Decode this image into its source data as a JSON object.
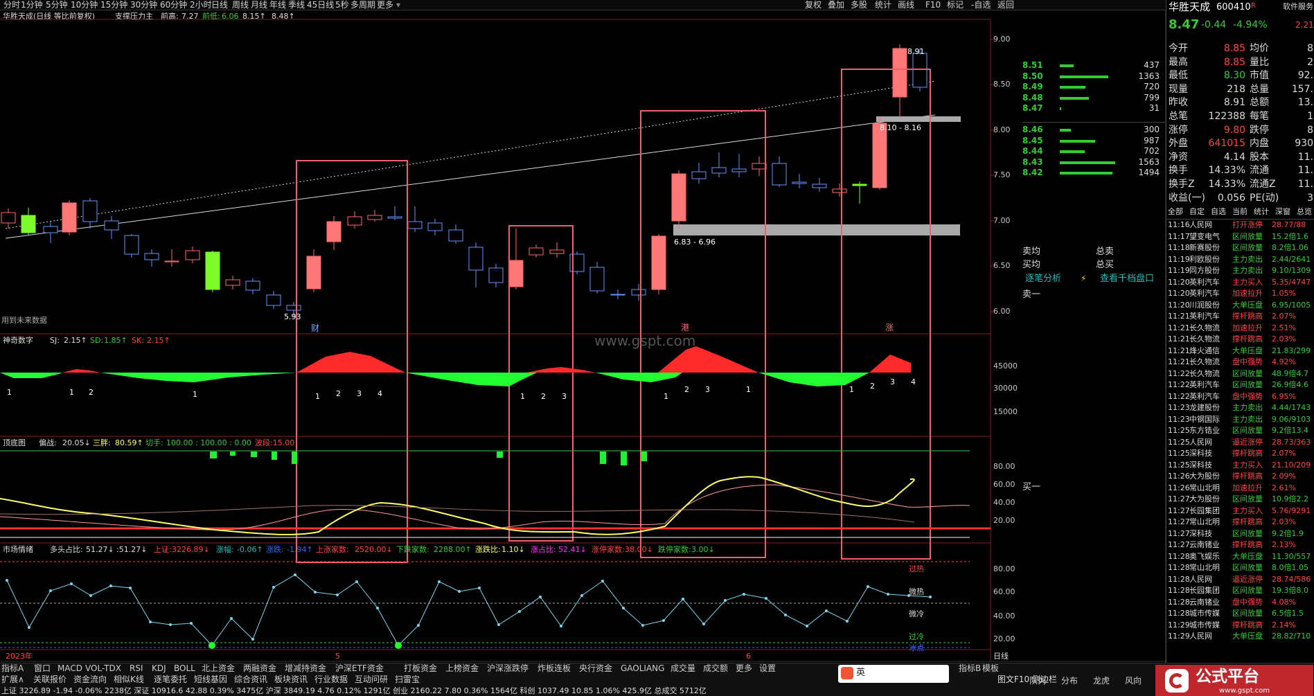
{
  "period_tabs": [
    "分时",
    "1分钟",
    "5分钟",
    "10分钟",
    "15分钟",
    "30分钟",
    "60分钟",
    "2小时",
    "日线",
    "周线",
    "月线",
    "年线",
    "季线",
    "45日线",
    "5秒",
    "多周期",
    "更多"
  ],
  "right_tools": [
    "复权",
    "叠加",
    "多股",
    "统计",
    "画线",
    "F10",
    "标记",
    "-自选",
    "返回"
  ],
  "chart_header": {
    "stock": "华胜天成(日线 等比前复权)",
    "indicator": "支撑压力主",
    "prev_high_label": "前高:",
    "prev_high": "7.27",
    "prev_low_label": "前低:",
    "prev_low": "6.06",
    "v1": "8.15↑",
    "v2": "8.48↑"
  },
  "price_axis": [
    "9.00",
    "8.50",
    "8.00",
    "7.50",
    "7.00",
    "6.50",
    "6.00"
  ],
  "annotations": {
    "high": "8.91",
    "low": "5.93",
    "zone_upper": "8.10 - 8.16",
    "zone_lower": "6.83 - 6.96",
    "future_note": "用到未来数据",
    "mark_cai": "财",
    "mark_gang": "港",
    "mark_zhang": "涨",
    "watermark": "www.gspt.com"
  },
  "panel2": {
    "name": "神奇数字",
    "sj_label": "SJ:",
    "sj": "2.15↑",
    "sd_label": "SD:",
    "sd": "1.85↑",
    "sk_label": "SK:",
    "sk": "2.15↑",
    "axis": [
      "45000",
      "30000",
      "15000"
    ],
    "counts": [
      "1",
      "1",
      "2",
      "1",
      "1",
      "2",
      "3",
      "4",
      "1",
      "2",
      "3",
      "1",
      "2",
      "3",
      "1",
      "1",
      "2",
      "3",
      "4"
    ]
  },
  "panel3": {
    "name": "顶底图",
    "a_label": "偏战:",
    "a": "20.05↓",
    "b_label": "三胖:",
    "b": "80.59↑",
    "c_label": "切手:",
    "c": "100.00 : 100.00 : 0.00",
    "d": "波段:15.00",
    "axis": [
      "80.00",
      "60.00",
      "40.00",
      "20.00"
    ]
  },
  "panel4": {
    "name": "市场情绪",
    "bull_label": "多头占比:",
    "bull": "51.27↓",
    "v2": ":51.27↓",
    "sh_label": "上证:",
    "sh": "3226.89↓",
    "zf_label": "涨幅:",
    "zf": "-0.06↑",
    "zd_label": "涨跌:",
    "zd": "-1.94↑",
    "up_label": "上涨家数:",
    "up": "2520.00↓",
    "down_label": "下跌家数:",
    "down": "2288.00↑",
    "ratio_label": "涨跌比:",
    "ratio": "1.10↓",
    "zzb_label": "涨占比:",
    "zzb": "52.41↓",
    "zt_label": "涨停家数:",
    "zt": "38.00↓",
    "dt_label": "跌停家数:",
    "dt": "3.00↓",
    "axis": [
      "80.00",
      "60.00",
      "40.00",
      "20.00"
    ],
    "zones": [
      "过热",
      "微热",
      "微冷",
      "过冷",
      "冰点"
    ]
  },
  "dates": [
    "2023年",
    "5",
    "6"
  ],
  "side": {
    "name": "华胜天成",
    "code": "600410",
    "badge": "R",
    "price": "8.47",
    "change": "-0.44",
    "pct": "-4.94%",
    "software": "软件服务",
    "extra": "2.21",
    "order_book": [
      {
        "p": "8.51",
        "v": "437",
        "w": 0.25
      },
      {
        "p": "8.50",
        "v": "1363",
        "w": 0.88
      },
      {
        "p": "8.49",
        "v": "720",
        "w": 0.46
      },
      {
        "p": "8.48",
        "v": "799",
        "w": 0.52
      },
      {
        "p": "8.47",
        "v": "31",
        "w": 0.03
      },
      {
        "p": "8.46",
        "v": "300",
        "w": 0.2
      },
      {
        "p": "8.45",
        "v": "987",
        "w": 0.64
      },
      {
        "p": "8.44",
        "v": "702",
        "w": 0.45
      },
      {
        "p": "8.43",
        "v": "1563",
        "w": 1.0
      },
      {
        "p": "8.42",
        "v": "1494",
        "w": 0.95
      }
    ],
    "stats": [
      {
        "l": "今开",
        "v": "8.85",
        "l2": "均价",
        "v2": "8"
      },
      {
        "l": "最高",
        "v": "8.85",
        "l2": "量比",
        "v2": "2"
      },
      {
        "l": "最低",
        "v": "8.30",
        "l2": "市值",
        "v2": "92."
      },
      {
        "l": "现量",
        "v": "218",
        "l2": "总量",
        "v2": "157."
      },
      {
        "l": "昨收",
        "v": "8.91",
        "l2": "总额",
        "v2": "13."
      },
      {
        "l": "总笔",
        "v": "122388",
        "l2": "每笔",
        "v2": "1"
      },
      {
        "l": "涨停",
        "v": "9.80",
        "l2": "跌停",
        "v2": "8"
      },
      {
        "l": "外盘",
        "v": "641015",
        "l2": "内盘",
        "v2": "930"
      },
      {
        "l": "净资",
        "v": "4.14",
        "l2": "股本",
        "v2": "11."
      },
      {
        "l": "换手",
        "v": "14.33%",
        "l2": "流通",
        "v2": "11."
      },
      {
        "l": "换手Z",
        "v": "14.33%",
        "l2": "流通Z",
        "v2": "11."
      },
      {
        "l": "收益(一)",
        "v": "0.056",
        "l2": "PE(动)",
        "v2": "3"
      }
    ],
    "tape_tabs": [
      "全部",
      "自定",
      "自选",
      "当前",
      "统计",
      "深窗",
      "总览"
    ],
    "tape": [
      {
        "t": "11:16",
        "n": "人民网",
        "a": "打开涨停",
        "v": "28.77/88"
      },
      {
        "t": "11:17",
        "n": "望变电气",
        "a": "区间放量",
        "v": "15.2倍1.6"
      },
      {
        "t": "11:18",
        "n": "新赛股份",
        "a": "区间放量",
        "v": "8.2倍1.06"
      },
      {
        "t": "11:19",
        "n": "利欧股份",
        "a": "主力卖出",
        "v": "2.44/2641"
      },
      {
        "t": "11:19",
        "n": "同方股份",
        "a": "主力卖出",
        "v": "9.10/1309"
      },
      {
        "t": "11:20",
        "n": "英利汽车",
        "a": "主力买入",
        "v": "5.35/4747"
      },
      {
        "t": "11:20",
        "n": "英利汽车",
        "a": "加速拉升",
        "v": "1.05%"
      },
      {
        "t": "11:20",
        "n": "川润股份",
        "a": "大单压盘",
        "v": "6.95/1005"
      },
      {
        "t": "11:21",
        "n": "英利汽车",
        "a": "撑杆跳高",
        "v": "2.07%"
      },
      {
        "t": "11:21",
        "n": "长久物流",
        "a": "加速拉升",
        "v": "2.51%"
      },
      {
        "t": "11:21",
        "n": "长久物流",
        "a": "撑杆跳高",
        "v": "2.03%"
      },
      {
        "t": "11:21",
        "n": "烽火通信",
        "a": "大单压盘",
        "v": "21.83/299"
      },
      {
        "t": "11:21",
        "n": "长久物流",
        "a": "盘中强势",
        "v": "4.92%"
      },
      {
        "t": "11:22",
        "n": "长久物流",
        "a": "区间放量",
        "v": "48.9倍4.7"
      },
      {
        "t": "11:22",
        "n": "英利汽车",
        "a": "区间放量",
        "v": "26.9倍4.6"
      },
      {
        "t": "11:22",
        "n": "英利汽车",
        "a": "盘中强势",
        "v": "6.95%"
      },
      {
        "t": "11:23",
        "n": "龙建股份",
        "a": "主力卖出",
        "v": "4.44/1743"
      },
      {
        "t": "11:23",
        "n": "中钢国际",
        "a": "主力卖出",
        "v": "9.06/9103"
      },
      {
        "t": "11:25",
        "n": "东方锆业",
        "a": "区间放量",
        "v": "9.2倍13.4"
      },
      {
        "t": "11:25",
        "n": "人民网",
        "a": "逼近涨停",
        "v": "28.73/363"
      },
      {
        "t": "11:25",
        "n": "深科技",
        "a": "撑杆跳高",
        "v": "2.07%"
      },
      {
        "t": "11:25",
        "n": "深科技",
        "a": "主力买入",
        "v": "21.10/209"
      },
      {
        "t": "11:26",
        "n": "大为股份",
        "a": "撑杆跳高",
        "v": "2.09%"
      },
      {
        "t": "11:26",
        "n": "常山北明",
        "a": "加速拉升",
        "v": "2.61%"
      },
      {
        "t": "11:27",
        "n": "大为股份",
        "a": "区间放量",
        "v": "10.9倍2.2"
      },
      {
        "t": "11:27",
        "n": "长园集团",
        "a": "主力买入",
        "v": "5.76/9291"
      },
      {
        "t": "11:27",
        "n": "常山北明",
        "a": "撑杆跳高",
        "v": "2.03%"
      },
      {
        "t": "11:27",
        "n": "深科技",
        "a": "区间放量",
        "v": "9.2倍1.9"
      },
      {
        "t": "11:27",
        "n": "云南锗业",
        "a": "撑杆跳高",
        "v": "2.13%"
      },
      {
        "t": "11:28",
        "n": "奥飞娱乐",
        "a": "大单压盘",
        "v": "11.30/557"
      },
      {
        "t": "11:28",
        "n": "常山北明",
        "a": "区间放量",
        "v": "8.0倍1.05"
      },
      {
        "t": "11:28",
        "n": "人民网",
        "a": "逼近涨停",
        "v": "28.74/586"
      },
      {
        "t": "11:28",
        "n": "长园集团",
        "a": "区间放量",
        "v": "19.3倍8.0"
      },
      {
        "t": "11:28",
        "n": "云南锗业",
        "a": "盘中强势",
        "v": "4.08%"
      },
      {
        "t": "11:28",
        "n": "城市传媒",
        "a": "区间放量",
        "v": "6.5倍1.5"
      },
      {
        "t": "11:29",
        "n": "城市传媒",
        "a": "撑杆跳高",
        "v": "2.14%"
      },
      {
        "t": "11:29",
        "n": "人民网",
        "a": "大单压盘",
        "v": "28.82/710"
      }
    ]
  },
  "mid": {
    "sell_avg": "卖均",
    "buy_avg": "买均",
    "total_sell": "总卖",
    "total_buy": "总买",
    "tick": "逐笔分析",
    "depth": "查看千档盘口",
    "sell1": "卖一",
    "buy1": "买一"
  },
  "indicator_tabs": [
    "指标A",
    "窗口",
    "MACD",
    "VOL-TDX",
    "RSI",
    "KDJ",
    "BOLL",
    "北上资金",
    "两融资金",
    "增减持资金",
    "沪深ETF资金",
    "打板资金",
    "上榜资金",
    "沪深涨跌停",
    "炸板连板",
    "央行资金",
    "GAOLIANG",
    "成交量",
    "成交额",
    "更多",
    "设置"
  ],
  "right_tabs": [
    "指标B",
    "模板"
  ],
  "sub_tabs": [
    "扩展∧",
    "关联报价",
    "资金流向",
    "相似K线",
    "逐笔委托",
    "短线基因",
    "综合资讯",
    "板块资讯",
    "行业数据",
    "互动问研",
    "扫雷宝"
  ],
  "status": "上证 3226.89 -1.94 -0.06% 2238亿  深证 10916.6 42.88 0.39% 3475亿  沪深 3849.19 4.76 0.12% 1291亿  创业 2160.22 7.80 0.36% 1564亿  科创 1037.49 10.85 1.06% 425.9亿  总成交 5712亿",
  "dock_tabs": [
    "队列",
    "分布",
    "龙虎",
    "风向"
  ],
  "period_label": "日线",
  "brand": "公式平台",
  "brand_url": "www.gspt.com",
  "ime": "英",
  "bottom_right": "图文F10 侧边栏"
}
